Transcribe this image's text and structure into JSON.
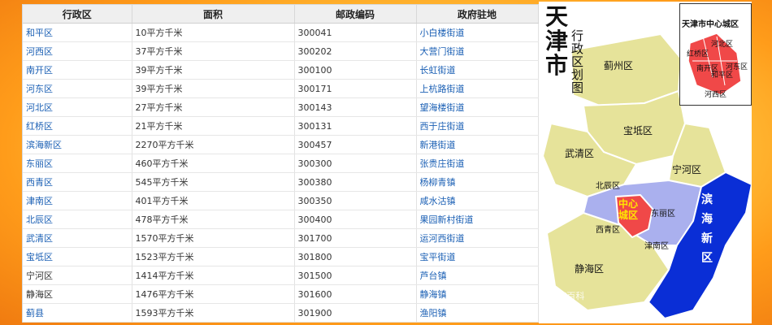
{
  "table": {
    "headers": [
      "行政区",
      "面积",
      "邮政编码",
      "政府驻地"
    ],
    "rows": [
      {
        "district": "和平区",
        "area": "10平方千米",
        "postal": "300041",
        "seat": "小白楼街道"
      },
      {
        "district": "河西区",
        "area": "37平方千米",
        "postal": "300202",
        "seat": "大营门街道"
      },
      {
        "district": "南开区",
        "area": "39平方千米",
        "postal": "300100",
        "seat": "长虹街道"
      },
      {
        "district": "河东区",
        "area": "39平方千米",
        "postal": "300171",
        "seat": "上杭路街道"
      },
      {
        "district": "河北区",
        "area": "27平方千米",
        "postal": "300143",
        "seat": "望海楼街道"
      },
      {
        "district": "红桥区",
        "area": "21平方千米",
        "postal": "300131",
        "seat": "西于庄街道"
      },
      {
        "district": "滨海新区",
        "area": "2270平方千米",
        "postal": "300457",
        "seat": "新港街道"
      },
      {
        "district": "东丽区",
        "area": "460平方千米",
        "postal": "300300",
        "seat": "张贵庄街道"
      },
      {
        "district": "西青区",
        "area": "545平方千米",
        "postal": "300380",
        "seat": "杨柳青镇"
      },
      {
        "district": "津南区",
        "area": "401平方千米",
        "postal": "300350",
        "seat": "咸水沽镇"
      },
      {
        "district": "北辰区",
        "area": "478平方千米",
        "postal": "300400",
        "seat": "果园新村街道"
      },
      {
        "district": "武清区",
        "area": "1570平方千米",
        "postal": "301700",
        "seat": "运河西街道"
      },
      {
        "district": "宝坻区",
        "area": "1523平方千米",
        "postal": "301800",
        "seat": "宝平街道"
      },
      {
        "district": "宁河区",
        "area": "1414平方千米",
        "postal": "301500",
        "seat": "芦台镇"
      },
      {
        "district": "静海区",
        "area": "1476平方千米",
        "postal": "301600",
        "seat": "静海镇"
      },
      {
        "district": "蓟县",
        "area": "1593平方千米",
        "postal": "301900",
        "seat": "渔阳镇"
      }
    ],
    "district_link_color": "#1a5fb4",
    "plain_district_rows": [
      "宁河区",
      "静海区"
    ]
  },
  "map": {
    "title": "天津市",
    "subtitle": "行政区划图",
    "inset_title": "天津市中心城区",
    "inset_labels": [
      "红桥区",
      "河北区",
      "南开区",
      "和平区",
      "河东区",
      "河西区"
    ],
    "labels": {
      "jixian": "蓟州区",
      "baodi": "宝坻区",
      "wuqing": "武清区",
      "ninghe": "宁河区",
      "beichen": "北辰区",
      "center": "中心城区",
      "dongli": "东丽区",
      "xiqing": "西青区",
      "jinnan": "津南区",
      "jinghai": "静海区",
      "binhai": "滨海新区"
    },
    "watermark": "Bai度百科",
    "colors": {
      "outer_districts": "#e6e39a",
      "inner_ring": "#aab0ee",
      "center": "#f04848",
      "binhai": "#0a2ed6"
    }
  }
}
